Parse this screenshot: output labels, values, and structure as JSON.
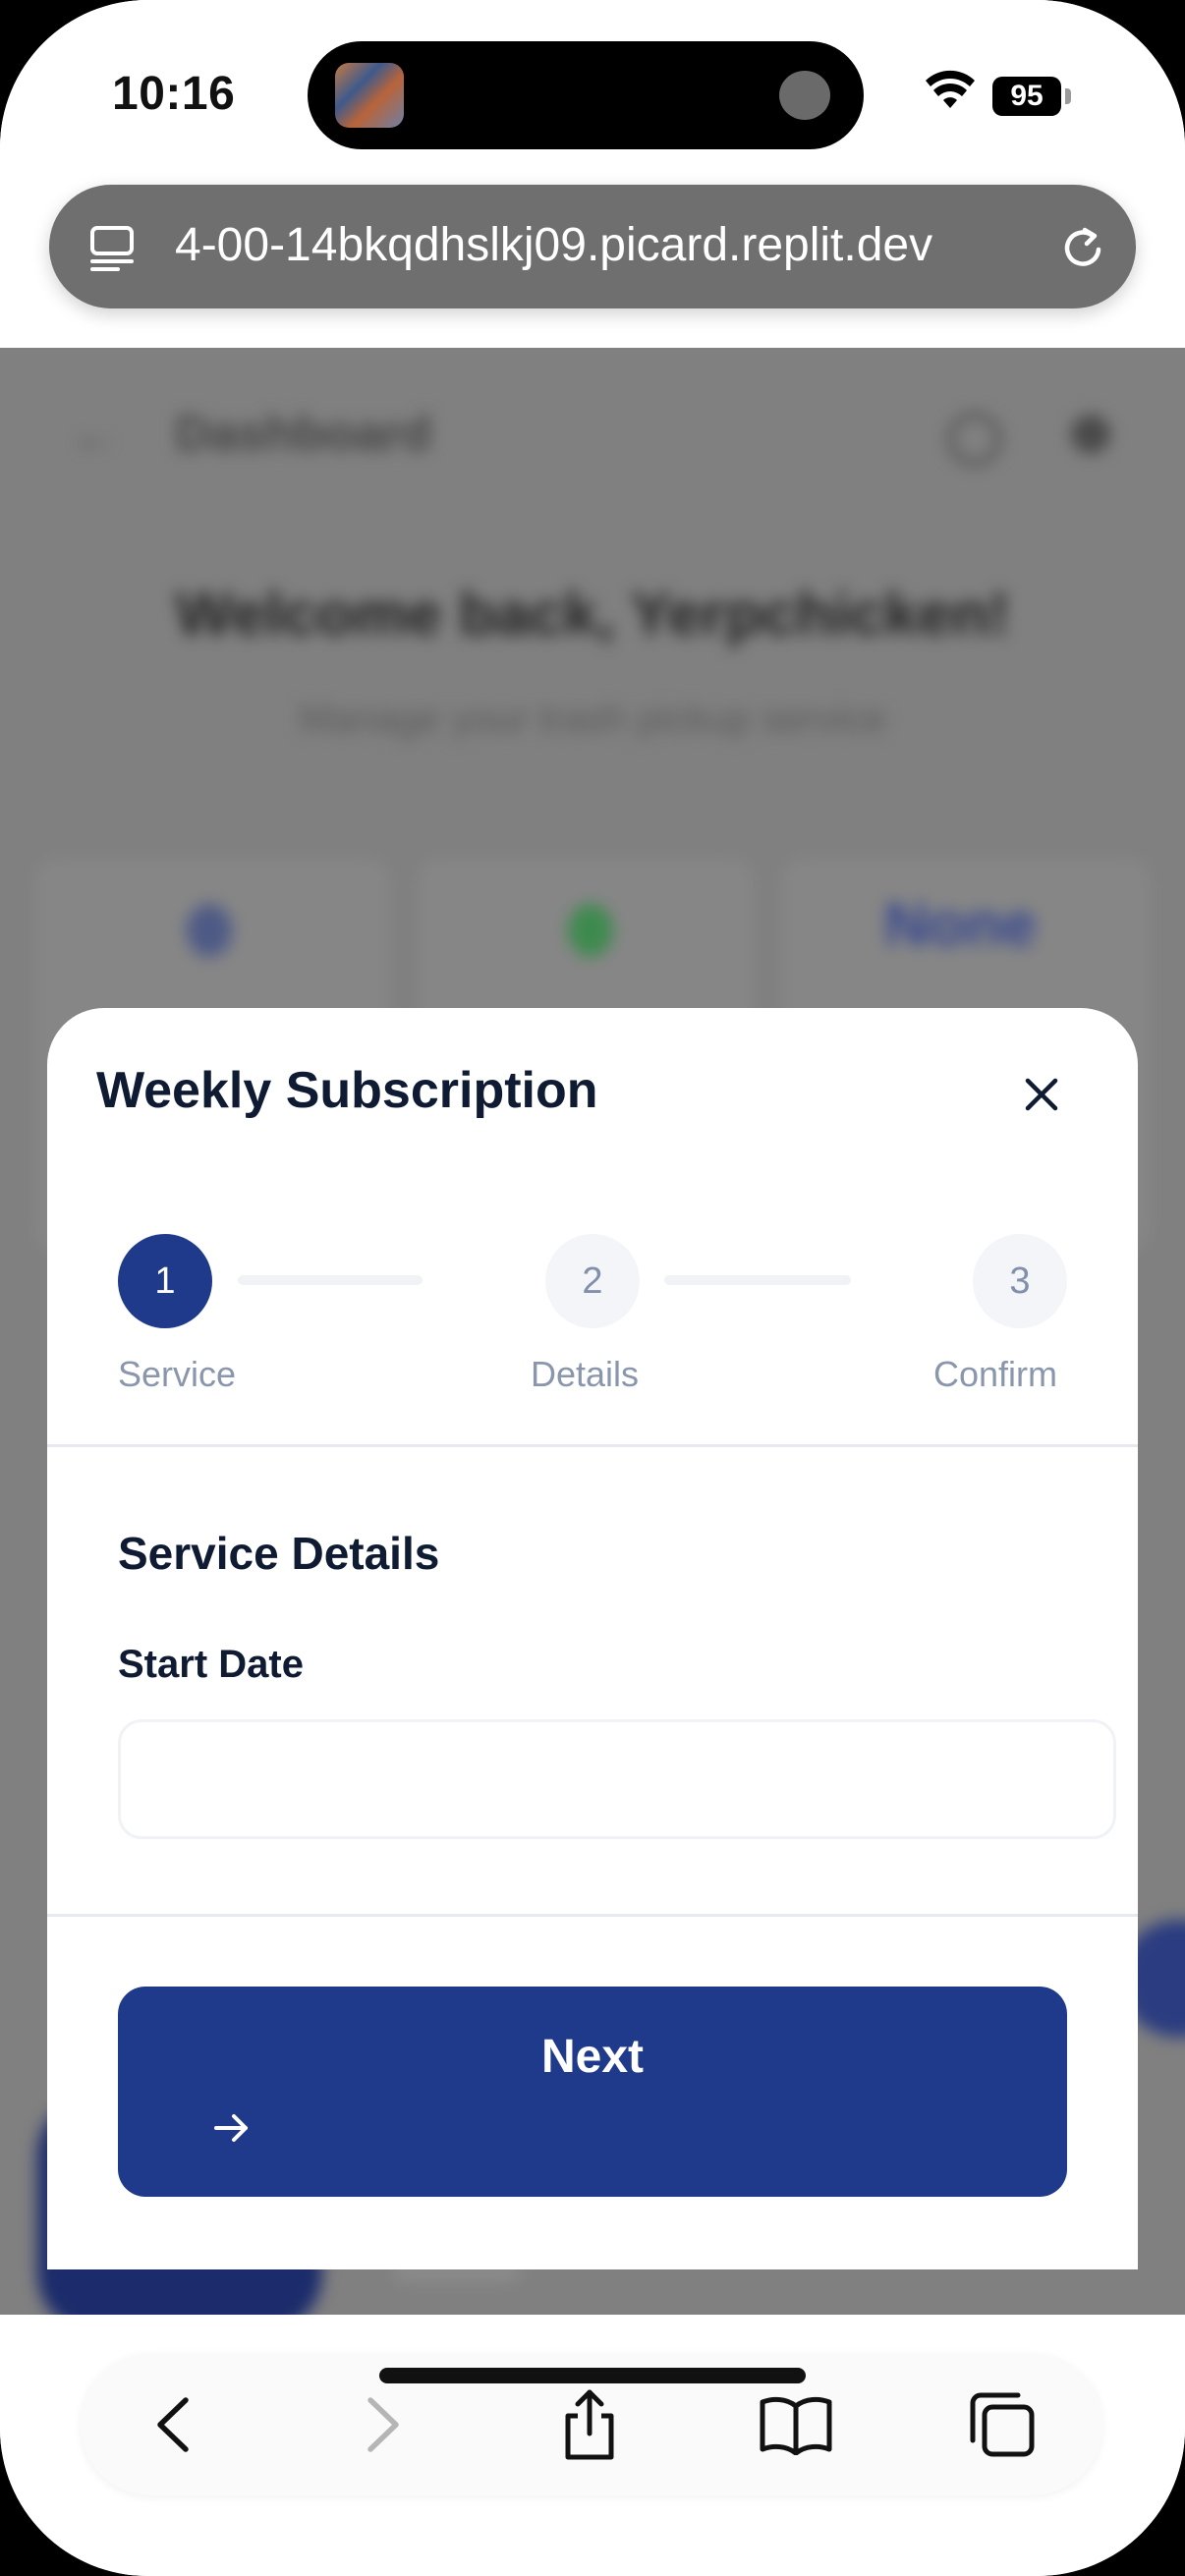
{
  "status_bar": {
    "time": "10:16",
    "battery": "95"
  },
  "browser": {
    "url": "4-00-14bkqdhslkj09.picard.replit.dev"
  },
  "background_page": {
    "header_title": "Dashboard",
    "welcome": "Welcome back, Yerpchicken!",
    "subtitle": "Manage your trash pickup service",
    "stat_value": "None"
  },
  "modal": {
    "title": "Weekly Subscription",
    "steps": [
      {
        "number": "1",
        "label": "Service",
        "state": "active"
      },
      {
        "number": "2",
        "label": "Details",
        "state": "inactive"
      },
      {
        "number": "3",
        "label": "Confirm",
        "state": "inactive"
      }
    ],
    "section_title": "Service Details",
    "start_date_label": "Start Date",
    "start_date_value": "",
    "next_label": "Next"
  },
  "colors": {
    "primary": "#1f3a8a",
    "overlay": "#808080",
    "text_dark": "#0f1a33",
    "muted": "#8a96ab"
  }
}
